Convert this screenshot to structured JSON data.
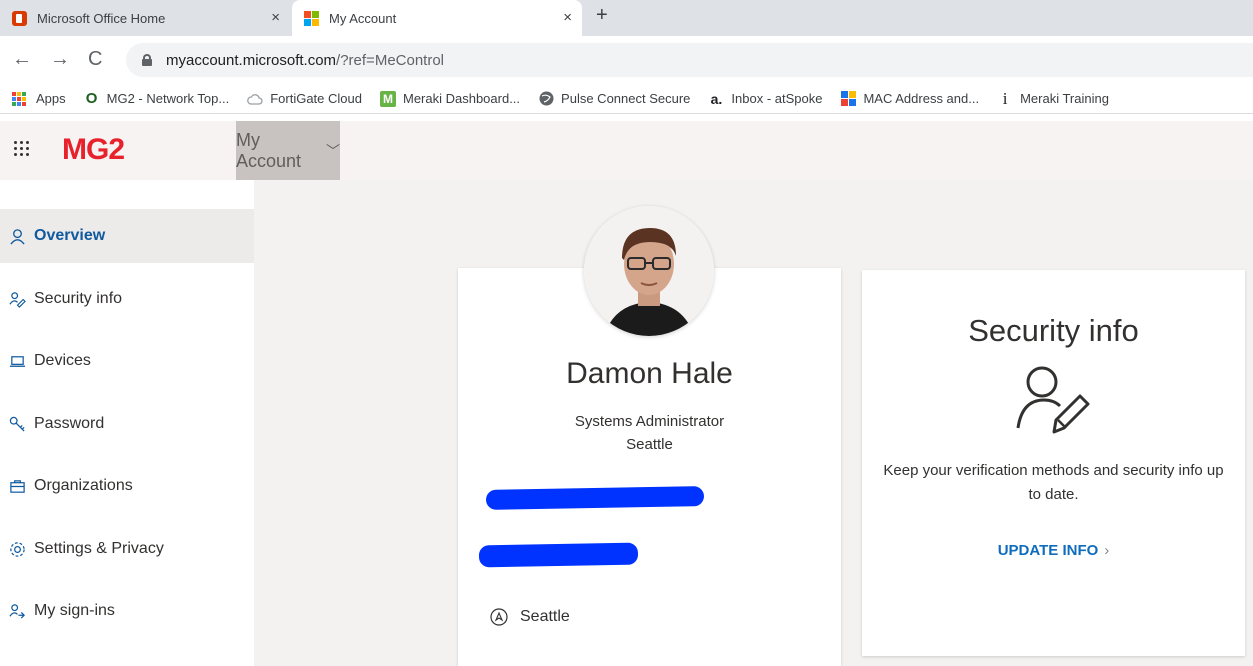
{
  "browser": {
    "tabs": [
      {
        "title": "Microsoft Office Home",
        "icon": "office-icon",
        "active": false
      },
      {
        "title": "My Account",
        "icon": "microsoft-logo-icon",
        "active": true
      }
    ],
    "close_glyph": "×",
    "new_tab_glyph": "+",
    "url_host": "myaccount.microsoft.com",
    "url_path": "/?ref=MeControl",
    "bookmarks": [
      {
        "label": "Apps",
        "icon": "apps-grid-icon"
      },
      {
        "label": "MG2 - Network Top...",
        "icon": "circle-icon",
        "glyph": "O"
      },
      {
        "label": "FortiGate Cloud",
        "icon": "cloud-icon"
      },
      {
        "label": "Meraki Dashboard...",
        "icon": "meraki-icon",
        "glyph": "M"
      },
      {
        "label": "Pulse Connect Secure",
        "icon": "globe-icon"
      },
      {
        "label": "Inbox - atSpoke",
        "icon": "atspoke-icon",
        "glyph": "a."
      },
      {
        "label": "MAC Address and...",
        "icon": "mac-lookup-icon"
      },
      {
        "label": "Meraki Training",
        "icon": "info-icon",
        "glyph": "i"
      }
    ]
  },
  "app": {
    "logo": "MG2",
    "section": "My Account",
    "brand_color": "#e8222c",
    "accent_color": "#0f6cbd"
  },
  "sidebar": {
    "items": [
      {
        "label": "Overview",
        "icon": "person-icon",
        "active": true
      },
      {
        "label": "Security info",
        "icon": "security-key-icon",
        "active": false
      },
      {
        "label": "Devices",
        "icon": "laptop-icon",
        "active": false
      },
      {
        "label": "Password",
        "icon": "key-icon",
        "active": false
      },
      {
        "label": "Organizations",
        "icon": "briefcase-icon",
        "active": false
      },
      {
        "label": "Settings & Privacy",
        "icon": "gear-icon",
        "active": false
      },
      {
        "label": "My sign-ins",
        "icon": "signins-icon",
        "active": false
      }
    ]
  },
  "profile": {
    "name": "Damon Hale",
    "title": "Systems Administrator",
    "city": "Seattle",
    "location": "Seattle"
  },
  "security_card": {
    "title": "Security info",
    "description": "Keep your verification methods and security info up to date.",
    "link_label": "UPDATE INFO",
    "link_arrow": "›"
  }
}
